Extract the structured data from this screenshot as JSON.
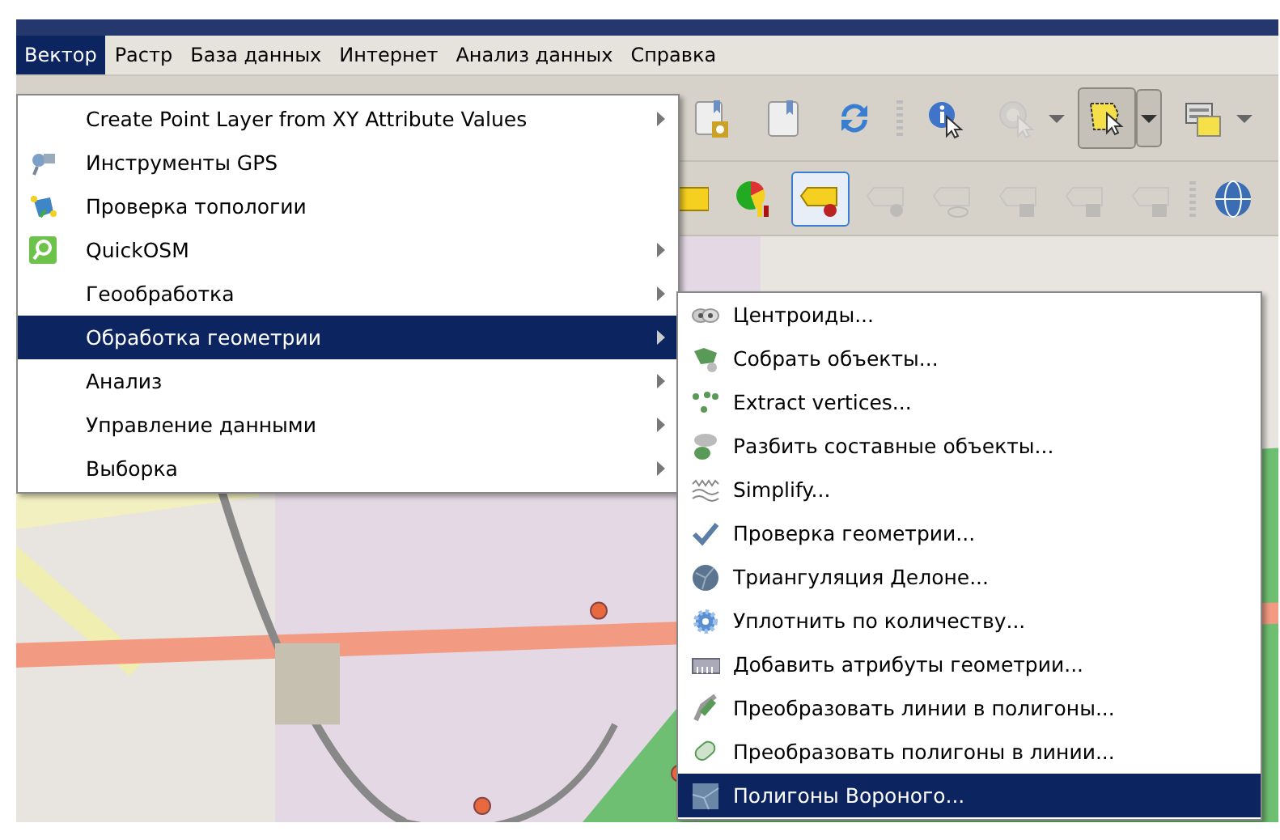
{
  "menubar": [
    {
      "label": "Вектор",
      "selected": true
    },
    {
      "label": "Растр",
      "selected": false
    },
    {
      "label": "База данных",
      "selected": false
    },
    {
      "label": "Интернет",
      "selected": false
    },
    {
      "label": "Анализ данных",
      "selected": false
    },
    {
      "label": "Справка",
      "selected": false
    }
  ],
  "toolbars": [
    {
      "buttons": [
        {
          "pressed": false,
          "disabled": false
        },
        {
          "pressed": false,
          "disabled": false
        },
        {
          "pressed": false,
          "disabled": false
        },
        {
          "pressed": false,
          "disabled": false
        },
        {
          "pressed": false,
          "disabled": true
        },
        {
          "pressed": true,
          "disabled": false
        },
        {
          "pressed": false,
          "disabled": false
        }
      ]
    },
    {
      "buttons": [
        {
          "pressed": false,
          "disabled": false
        },
        {
          "pressed": false,
          "disabled": false
        },
        {
          "pressed": true,
          "disabled": false
        },
        {
          "pressed": false,
          "disabled": true
        },
        {
          "pressed": false,
          "disabled": true
        },
        {
          "pressed": false,
          "disabled": true
        },
        {
          "pressed": false,
          "disabled": true
        },
        {
          "pressed": false,
          "disabled": true
        },
        {
          "pressed": false,
          "disabled": false
        }
      ]
    }
  ],
  "vector_menu": {
    "items": [
      {
        "label": "Create Point Layer from XY Attribute Values",
        "submenu": true,
        "selected": false
      },
      {
        "label": "Инструменты GPS",
        "submenu": false,
        "selected": false
      },
      {
        "label": "Проверка топологии",
        "submenu": false,
        "selected": false
      },
      {
        "label": "QuickOSM",
        "submenu": true,
        "selected": false
      },
      {
        "label": "Геообработка",
        "submenu": true,
        "selected": false
      },
      {
        "label": "Обработка геометрии",
        "submenu": true,
        "selected": true
      },
      {
        "label": "Анализ",
        "submenu": true,
        "selected": false
      },
      {
        "label": "Управление данными",
        "submenu": true,
        "selected": false
      },
      {
        "label": "Выборка",
        "submenu": true,
        "selected": false
      }
    ]
  },
  "geometry_submenu": {
    "items": [
      {
        "label": "Центроиды...",
        "selected": false
      },
      {
        "label": "Собрать объекты...",
        "selected": false
      },
      {
        "label": "Extract vertices...",
        "selected": false
      },
      {
        "label": "Разбить составные объекты...",
        "selected": false
      },
      {
        "label": "Simplify...",
        "selected": false
      },
      {
        "label": "Проверка геометрии...",
        "selected": false
      },
      {
        "label": "Триангуляция Делоне...",
        "selected": false
      },
      {
        "label": "Уплотнить по количеству...",
        "selected": false
      },
      {
        "label": "Добавить атрибуты геометрии...",
        "selected": false
      },
      {
        "label": "Преобразовать линии в полигоны...",
        "selected": false
      },
      {
        "label": "Преобразовать полигоны в линии...",
        "selected": false
      },
      {
        "label": "Полигоны Вороного...",
        "selected": true
      }
    ]
  }
}
